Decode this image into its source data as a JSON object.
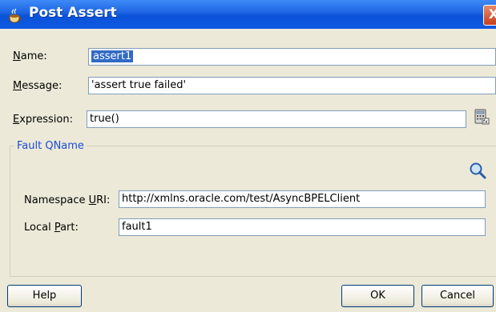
{
  "window": {
    "title": "Post Assert",
    "close_glyph": "X"
  },
  "form": {
    "name": {
      "label_u": "N",
      "label_rest": "ame:",
      "value": "assert1"
    },
    "message": {
      "label_u": "M",
      "label_rest": "essage:",
      "value": "'assert true failed'"
    },
    "expression": {
      "label_u": "E",
      "label_rest": "xpression:",
      "value": "true()"
    }
  },
  "fault": {
    "group_title": "Fault QName",
    "namespace": {
      "label_pre": "Namespace ",
      "label_u": "U",
      "label_rest": "RI:",
      "value": "http://xmlns.oracle.com/test/AsyncBPELClient"
    },
    "local_part": {
      "label_pre": "Local ",
      "label_u": "P",
      "label_rest": "art:",
      "value": "fault1"
    }
  },
  "buttons": {
    "help": "Help",
    "ok": "OK",
    "cancel": "Cancel"
  },
  "icons": {
    "title": "coffee-cup-icon",
    "expression_builder": "calculator-icon",
    "browse": "magnifier-icon"
  }
}
